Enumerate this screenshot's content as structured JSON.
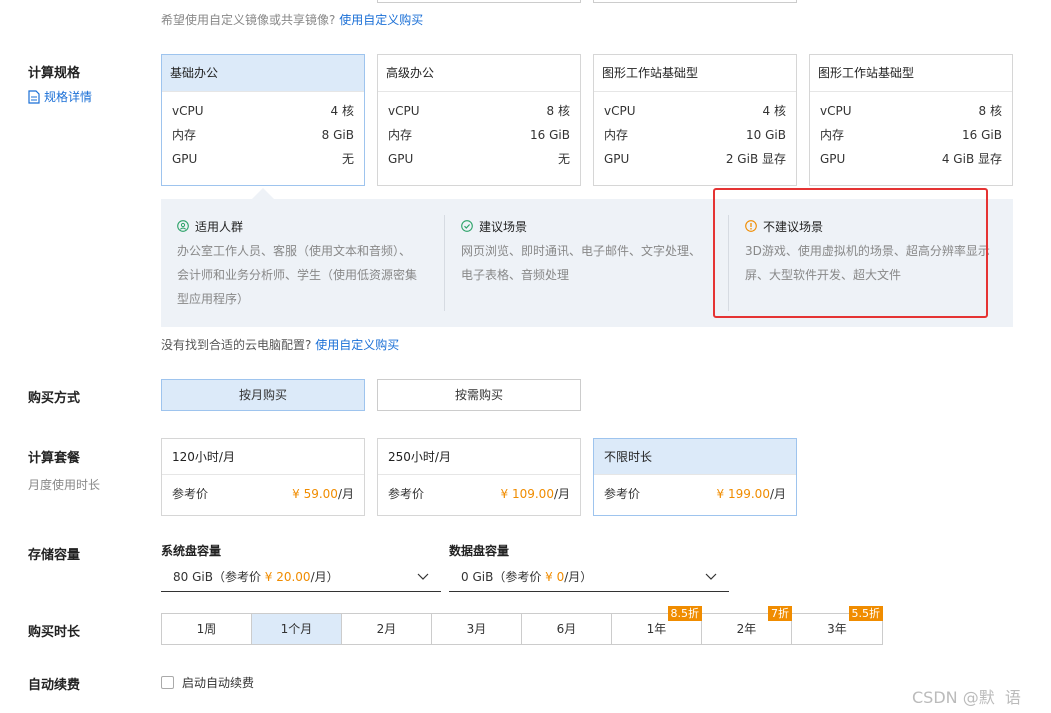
{
  "top_note": {
    "text": "希望使用自定义镜像或共享镜像?",
    "link": "使用自定义购买"
  },
  "compute_spec": {
    "label": "计算规格",
    "details_link": "规格详情",
    "cards": [
      {
        "name": "基础办公",
        "vcpu_label": "vCPU",
        "vcpu": "4 核",
        "mem_label": "内存",
        "mem": "8 GiB",
        "gpu_label": "GPU",
        "gpu": "无",
        "selected": true
      },
      {
        "name": "高级办公",
        "vcpu_label": "vCPU",
        "vcpu": "8 核",
        "mem_label": "内存",
        "mem": "16 GiB",
        "gpu_label": "GPU",
        "gpu": "无",
        "selected": false
      },
      {
        "name": "图形工作站基础型",
        "vcpu_label": "vCPU",
        "vcpu": "4 核",
        "mem_label": "内存",
        "mem": "10 GiB",
        "gpu_label": "GPU",
        "gpu": "2 GiB 显存",
        "selected": false
      },
      {
        "name": "图形工作站基础型",
        "vcpu_label": "vCPU",
        "vcpu": "8 核",
        "mem_label": "内存",
        "mem": "16 GiB",
        "gpu_label": "GPU",
        "gpu": "4 GiB 显存",
        "selected": false
      }
    ],
    "info": {
      "audience": {
        "title": "适用人群",
        "lines": [
          "办公室工作人员、客服（使用文本和音频）、",
          "会计师和业务分析师、学生（使用低资源密集",
          "型应用程序）"
        ]
      },
      "recommended": {
        "title": "建议场景",
        "lines": [
          "网页浏览、即时通讯、电子邮件、文字处理、",
          "电子表格、音频处理"
        ]
      },
      "not_recommended": {
        "title": "不建议场景",
        "lines": [
          "3D游戏、使用虚拟机的场景、超高分辨率显示",
          "屏、大型软件开发、超大文件"
        ]
      }
    },
    "not_found": {
      "text": "没有找到合适的云电脑配置?",
      "link": "使用自定义购买"
    }
  },
  "purchase_method": {
    "label": "购买方式",
    "options": [
      "按月购买",
      "按需购买"
    ],
    "selected": "按月购买"
  },
  "plan": {
    "label": "计算套餐",
    "sublabel": "月度使用时长",
    "cards": [
      {
        "name": "120小时/月",
        "ref_label": "参考价",
        "price": "¥ 59.00",
        "unit": "/月",
        "selected": false
      },
      {
        "name": "250小时/月",
        "ref_label": "参考价",
        "price": "¥ 109.00",
        "unit": "/月",
        "selected": false
      },
      {
        "name": "不限时长",
        "ref_label": "参考价",
        "price": "¥ 199.00",
        "unit": "/月",
        "selected": true
      }
    ]
  },
  "storage": {
    "label": "存储容量",
    "system_disk": {
      "label": "系统盘容量",
      "value_prefix": "80 GiB（参考价 ",
      "price": "¥ 20.00",
      "value_suffix": "/月）"
    },
    "data_disk": {
      "label": "数据盘容量",
      "value_prefix": "0 GiB（参考价 ",
      "price": "¥ 0",
      "value_suffix": "/月）"
    }
  },
  "duration": {
    "label": "购买时长",
    "options": [
      {
        "label": "1周",
        "badge": ""
      },
      {
        "label": "1个月",
        "badge": ""
      },
      {
        "label": "2月",
        "badge": ""
      },
      {
        "label": "3月",
        "badge": ""
      },
      {
        "label": "6月",
        "badge": ""
      },
      {
        "label": "1年",
        "badge": "8.5折"
      },
      {
        "label": "2年",
        "badge": "7折"
      },
      {
        "label": "3年",
        "badge": "5.5折"
      }
    ],
    "selected": "1个月"
  },
  "auto_renew": {
    "label": "自动续费",
    "checkbox_label": "启动自动续费",
    "checked": false
  },
  "watermark": "CSDN @默  语",
  "colors": {
    "link": "#1a6fd6",
    "accent_price": "#f08c00",
    "selected_bg": "#dceaf9",
    "highlight_box": "#e53333",
    "info_bg": "#eef2f7"
  },
  "icons": {
    "spec_details": "document-icon",
    "audience": "user-circle-icon",
    "recommended": "check-circle-icon",
    "not_recommended": "warning-circle-icon",
    "dropdown": "chevron-down-icon"
  }
}
